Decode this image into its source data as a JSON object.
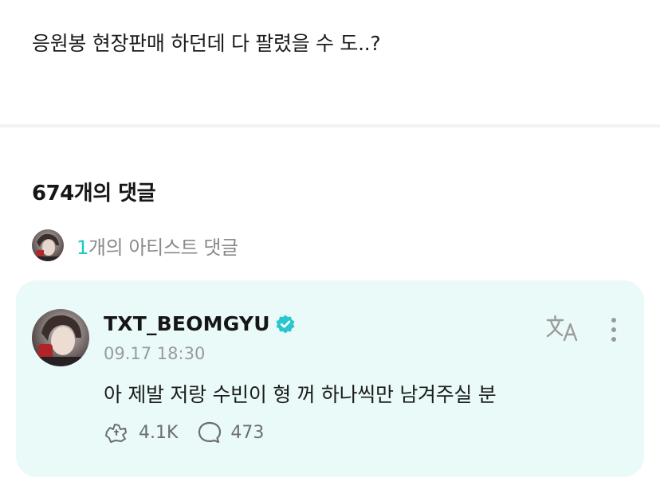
{
  "post": {
    "body": "응원봉 현장판매 하던데 다 팔렸을 수 도..?"
  },
  "comments_header": {
    "count_label": "674개의 댓글"
  },
  "artist_comments": {
    "count": "1",
    "label_suffix": "개의 아티스트 댓글",
    "accent_color": "#1bc9c9"
  },
  "comment": {
    "username": "TXT_BEOMGYU",
    "verified": true,
    "timestamp": "09.17 18:30",
    "text": "아 제발 저랑 수빈이 형 꺼 하나씩만 남겨주실 분",
    "likes": "4.1K",
    "replies": "473",
    "card_color": "#e9faf9",
    "verified_color": "#2ac6cd"
  },
  "icons": {
    "artist_avatar": "avatar",
    "verified": "verified-badge-icon",
    "translate": "translate-icon",
    "more": "more-vertical-icon",
    "like": "cheer-icon",
    "reply": "comment-bubble-icon"
  }
}
